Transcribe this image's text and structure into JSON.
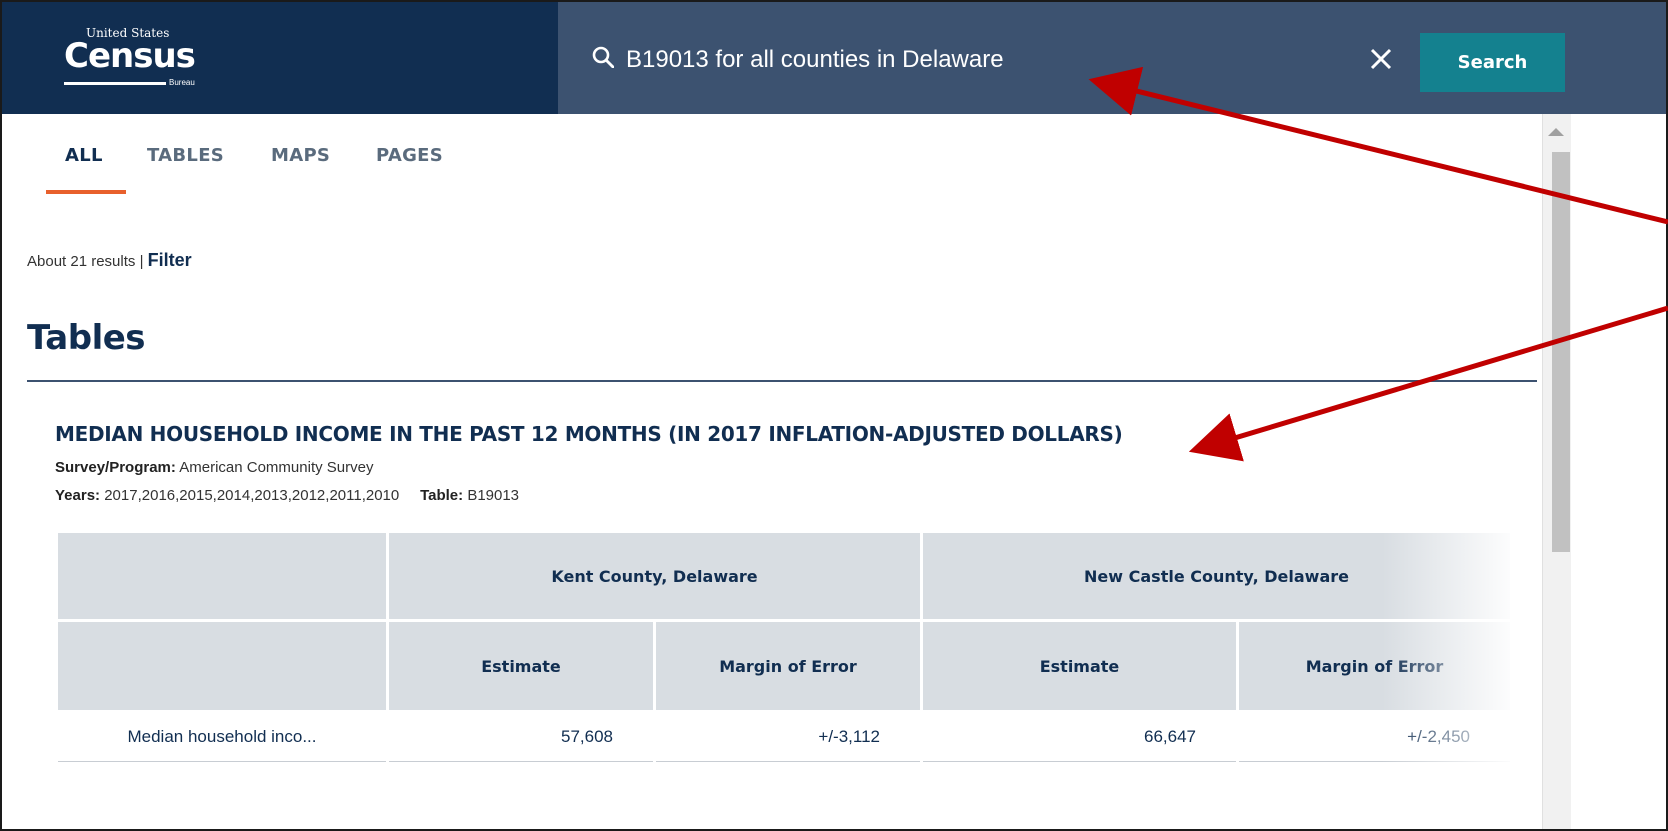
{
  "header": {
    "logo": {
      "top": "United States",
      "main": "Census",
      "bottom": "Bureau"
    },
    "search_value": "B19013 for all counties in Delaware",
    "search_button": "Search"
  },
  "tabs": [
    {
      "label": "ALL",
      "active": true
    },
    {
      "label": "TABLES",
      "active": false
    },
    {
      "label": "MAPS",
      "active": false
    },
    {
      "label": "PAGES",
      "active": false
    }
  ],
  "results": {
    "count_text": "About 21 results",
    "separator": "|",
    "filter_label": "Filter"
  },
  "section_title": "Tables",
  "table_result": {
    "title": "MEDIAN HOUSEHOLD INCOME IN THE PAST 12 MONTHS (IN 2017 INFLATION-ADJUSTED DOLLARS)",
    "survey_label": "Survey/Program:",
    "survey_value": "American Community Survey",
    "years_label": "Years:",
    "years_value": "2017,2016,2015,2014,2013,2012,2011,2010",
    "table_label": "Table:",
    "table_value": "B19013"
  },
  "data_table": {
    "geo_headers": [
      "Kent County, Delaware",
      "New Castle County, Delaware"
    ],
    "sub_headers": [
      "Estimate",
      "Margin of Error",
      "Estimate",
      "Margin of Error"
    ],
    "row": {
      "label": "Median household inco...",
      "values": [
        "57,608",
        "+/-3,112",
        "66,647",
        "+/-2,450"
      ]
    }
  },
  "colors": {
    "header_dark": "#112e51",
    "header_search": "#3c5270",
    "search_button": "#14818f",
    "tab_accent": "#e8602c",
    "annotation_arrow": "#c00000"
  }
}
